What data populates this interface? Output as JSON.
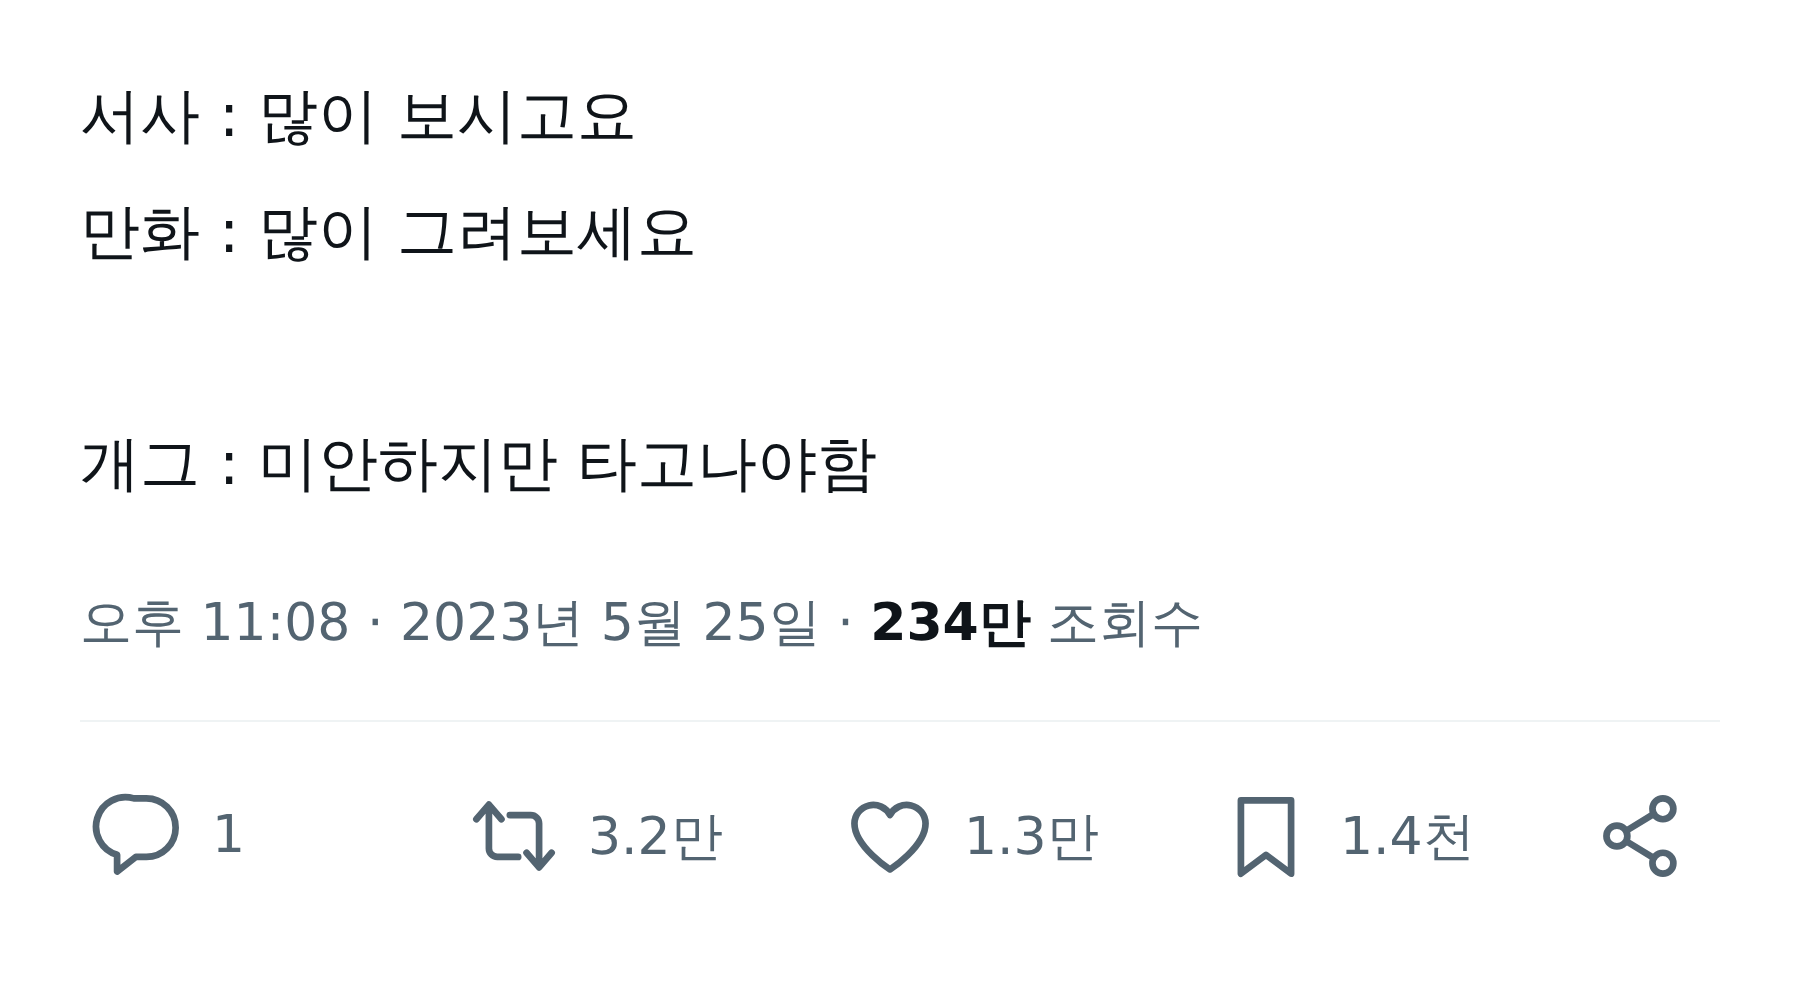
{
  "tweet": {
    "paragraphs": [
      [
        "서사 : 많이 보시고요",
        "만화 : 많이 그려보세요"
      ],
      [
        "개그 : 미안하지만 타고나야함"
      ]
    ],
    "meta": "오후 11:08 · 2023년 5월 25일 · **234만** 조회수",
    "actions": [
      {
        "kind": "reply",
        "count": "1"
      },
      {
        "kind": "retweet",
        "count": "3.2만"
      },
      {
        "kind": "like",
        "count": "1.3만"
      },
      {
        "kind": "bookmark",
        "count": "1.4천"
      },
      {
        "kind": "share"
      }
    ]
  }
}
